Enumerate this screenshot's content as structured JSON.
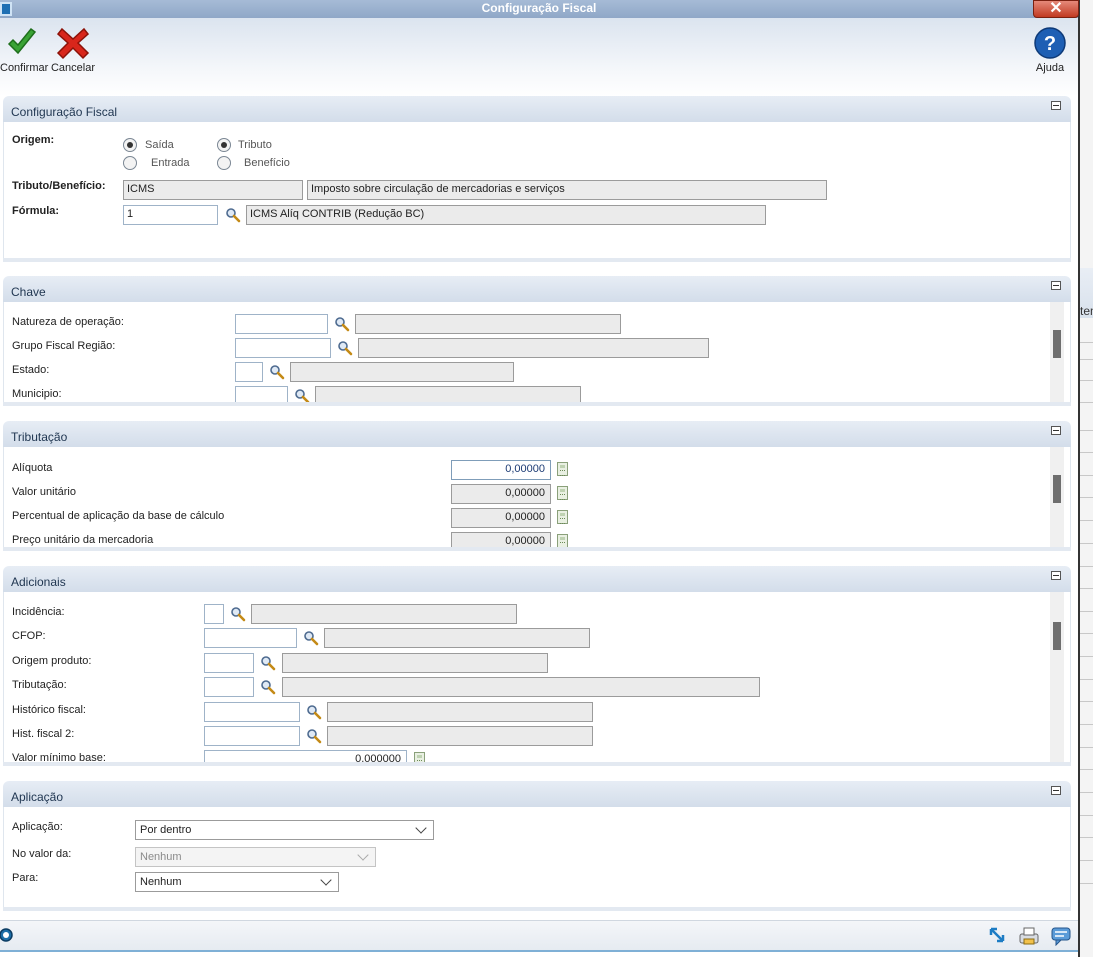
{
  "window": {
    "title": "Configuração Fiscal"
  },
  "toolbar": {
    "confirm_label": "Confirmar",
    "cancel_label": "Cancelar",
    "help_label": "Ajuda"
  },
  "background": {
    "header_fragment": "tem"
  },
  "config": {
    "section_title": "Configuração Fiscal",
    "origem_label": "Origem:",
    "radio_saida": "Saída",
    "radio_entrada": "Entrada",
    "radio_tributo": "Tributo",
    "radio_beneficio": "Benefício",
    "tributo_label": "Tributo/Benefício:",
    "tributo_code": "ICMS",
    "tributo_desc": "Imposto sobre circulação de mercadorias e serviços",
    "formula_label": "Fórmula:",
    "formula_code": "1",
    "formula_desc": "ICMS Alíq CONTRIB (Redução BC)"
  },
  "chave": {
    "section_title": "Chave",
    "natureza_label": "Natureza de operação:",
    "grupo_label": "Grupo Fiscal Região:",
    "estado_label": "Estado:",
    "municipio_label": "Municipio:"
  },
  "tributacao": {
    "section_title": "Tributação",
    "aliquota_label": "Alíquota",
    "aliquota_value": "0,00000",
    "valor_unit_label": "Valor unitário",
    "valor_unit_value": "0,00000",
    "percentual_label": "Percentual de aplicação da base de cálculo",
    "percentual_value": "0,00000",
    "preco_label": "Preço unitário da mercadoria",
    "preco_value": "0,00000"
  },
  "adicionais": {
    "section_title": "Adicionais",
    "incidencia_label": "Incidência:",
    "cfop_label": "CFOP:",
    "origem_produto_label": "Origem produto:",
    "tributacao_label": "Tributação:",
    "historico_label": "Histórico fiscal:",
    "hist2_label": "Hist. fiscal 2:",
    "valor_minimo_label": "Valor mínimo base:",
    "valor_minimo_value": "0,000000"
  },
  "aplicacao": {
    "section_title": "Aplicação",
    "aplicacao_label": "Aplicação:",
    "aplicacao_value": "Por dentro",
    "no_valor_label": "No valor da:",
    "no_valor_value": "Nenhum",
    "para_label": "Para:",
    "para_value": "Nenhum"
  },
  "colors": {
    "title_bar": "#8fa7c7",
    "panel_header": "#d3ddea",
    "confirm_green": "#3aa335",
    "cancel_red": "#d8261b",
    "help_blue": "#1e5fb4"
  }
}
